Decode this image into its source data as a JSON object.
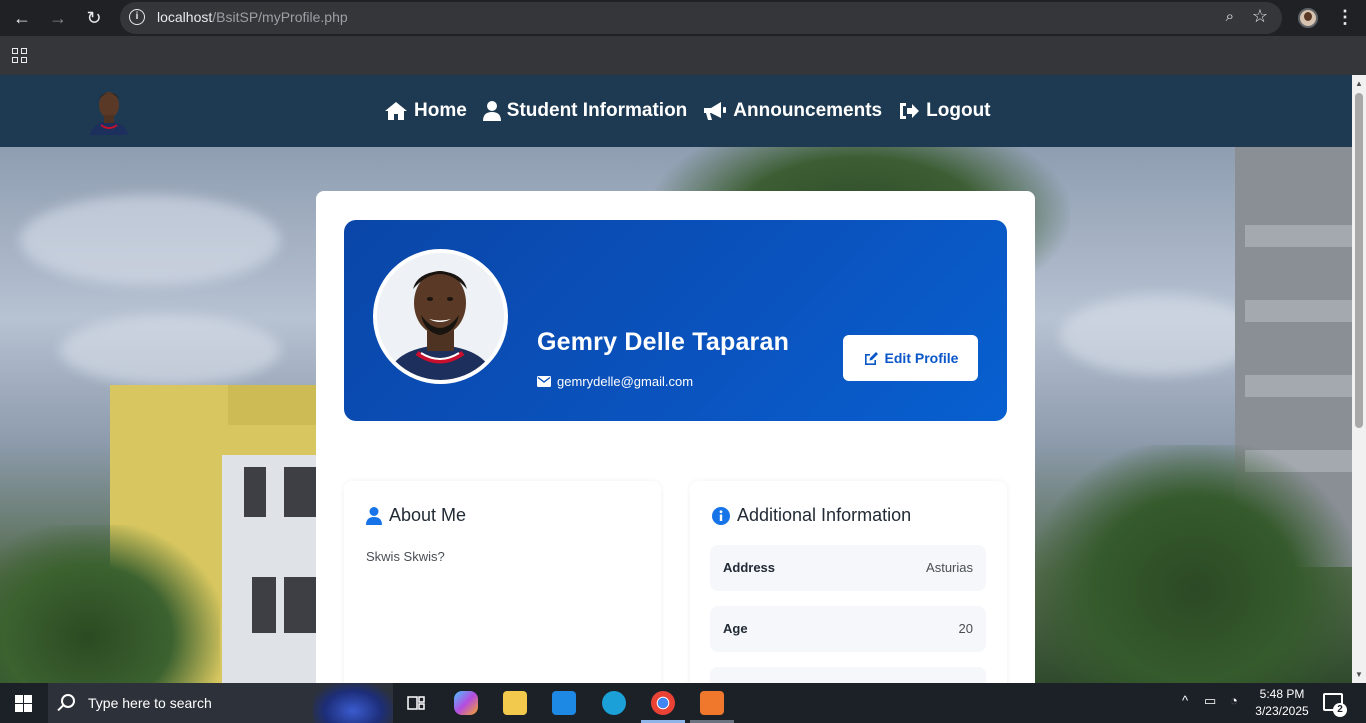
{
  "browser": {
    "url_host": "localhost",
    "url_path": "/BsitSP/myProfile.php"
  },
  "nav": {
    "items": [
      {
        "label": "Home",
        "icon": "home-icon"
      },
      {
        "label": "Student Information",
        "icon": "user-icon"
      },
      {
        "label": "Announcements",
        "icon": "bullhorn-icon"
      },
      {
        "label": "Logout",
        "icon": "sign-out-icon"
      }
    ]
  },
  "profile": {
    "name": "Gemry Delle Taparan",
    "email": "gemrydelle@gmail.com",
    "edit_label": "Edit Profile"
  },
  "about": {
    "title": "About Me",
    "text": "Skwis Skwis?"
  },
  "additional": {
    "title": "Additional Information",
    "rows": [
      {
        "key": "Address",
        "value": "Asturias"
      },
      {
        "key": "Age",
        "value": "20"
      }
    ]
  },
  "taskbar": {
    "search_placeholder": "Type here to search",
    "time": "5:48 PM",
    "date": "3/23/2025",
    "notification_count": "2"
  },
  "colors": {
    "navbar": "#1e3a52",
    "hero": "#0a52bd",
    "accent": "#0a56c8"
  }
}
